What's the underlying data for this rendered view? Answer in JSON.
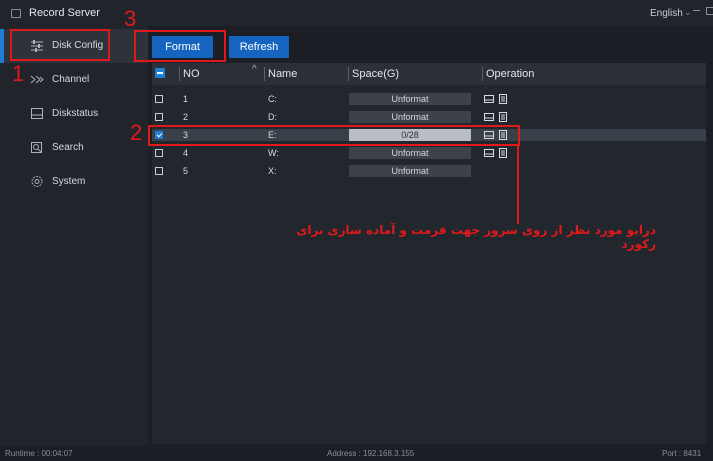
{
  "titlebar": {
    "app_title": "Record Server",
    "language": "English",
    "icons": [
      "app-icon",
      "chevron-down-icon",
      "minimize-icon",
      "maximize-icon"
    ]
  },
  "sidebar": {
    "items": [
      {
        "label": "Disk Config",
        "icon": "sliders-icon",
        "active": true
      },
      {
        "label": "Channel",
        "icon": "channel-icon",
        "active": false
      },
      {
        "label": "Diskstatus",
        "icon": "disk-icon",
        "active": false
      },
      {
        "label": "Search",
        "icon": "search-icon",
        "active": false
      },
      {
        "label": "System",
        "icon": "gear-icon",
        "active": false
      }
    ]
  },
  "toolbar": {
    "format_label": "Format",
    "refresh_label": "Refresh"
  },
  "table": {
    "columns": [
      "NO",
      "Name",
      "Space(G)",
      "Operation"
    ],
    "rows": [
      {
        "no": "1",
        "name": "C:",
        "space": "Unformat",
        "checked": false
      },
      {
        "no": "2",
        "name": "D:",
        "space": "Unformat",
        "checked": false
      },
      {
        "no": "3",
        "name": "E:",
        "space": "0/28",
        "checked": true
      },
      {
        "no": "4",
        "name": "W:",
        "space": "Unformat",
        "checked": false
      },
      {
        "no": "5",
        "name": "X:",
        "space": "Unformat",
        "checked": false
      }
    ]
  },
  "statusbar": {
    "runtime": "Runtime :  00:04:07",
    "address": "Address :  192.168.3.155",
    "port": "Port :  8431"
  },
  "annotations": {
    "marker_1": "1",
    "marker_2": "2",
    "marker_3": "3",
    "note": "درایو مورد نظر از روی سرور جهت فرمت و آماده سازی برای رکورد"
  },
  "colors": {
    "accent": "#1565c0",
    "highlight": "#e01a1a",
    "background": "#1b1e24"
  }
}
